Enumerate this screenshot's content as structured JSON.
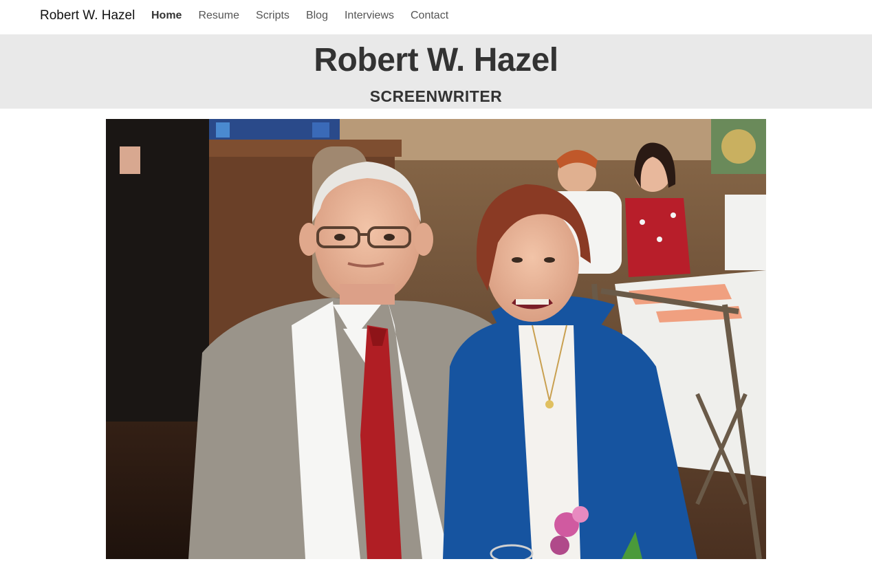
{
  "navbar": {
    "brand": "Robert W. Hazel",
    "links": [
      {
        "label": "Home",
        "active": true
      },
      {
        "label": "Resume",
        "active": false
      },
      {
        "label": "Scripts",
        "active": false
      },
      {
        "label": "Blog",
        "active": false
      },
      {
        "label": "Interviews",
        "active": false
      },
      {
        "label": "Contact",
        "active": false
      }
    ]
  },
  "hero": {
    "title": "Robert W. Hazel",
    "subtitle": "SCREENWRITER"
  },
  "colors": {
    "hero_background": "#e9e9e9",
    "navbar_background": "#ffffff",
    "text_dark": "#333333"
  }
}
